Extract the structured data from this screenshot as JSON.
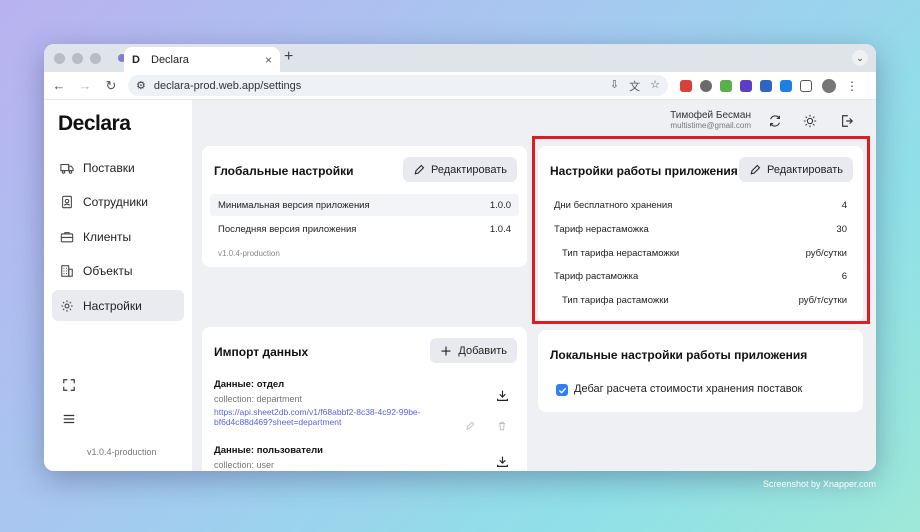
{
  "browser": {
    "tab_title": "Declara",
    "url": "declara-prod.web.app/settings"
  },
  "colors": {
    "accent": "#2d7ff9",
    "highlight": "#e11b22",
    "link": "#5b63d8"
  },
  "sidebar": {
    "logo": "Declara",
    "items": [
      {
        "label": "Поставки",
        "icon": "truck-icon"
      },
      {
        "label": "Сотрудники",
        "icon": "badge-icon"
      },
      {
        "label": "Клиенты",
        "icon": "briefcase-icon"
      },
      {
        "label": "Объекты",
        "icon": "building-icon"
      },
      {
        "label": "Настройки",
        "icon": "gear-icon"
      }
    ],
    "version": "v1.0.4-production"
  },
  "header": {
    "user_name": "Тимофей Бесман",
    "user_email": "multistime@gmail.com"
  },
  "global": {
    "title": "Глобальные настройки",
    "edit_label": "Редактировать",
    "rows": [
      {
        "label": "Минимальная версия приложения",
        "value": "1.0.0"
      },
      {
        "label": "Последняя версия приложения",
        "value": "1.0.4"
      }
    ],
    "version": "v1.0.4-production"
  },
  "app_settings": {
    "title": "Настройки работы приложения",
    "edit_label": "Редактировать",
    "rows": [
      {
        "label": "Дни бесплатного хранения",
        "value": "4"
      },
      {
        "label": "Тариф нерастаможка",
        "value": "30"
      },
      {
        "label": "Тип тарифа нерастаможки",
        "value": "руб/сутки"
      },
      {
        "label": "Тариф растаможка",
        "value": "6"
      },
      {
        "label": "Тип тарифа растаможки",
        "value": "руб/т/сутки"
      }
    ]
  },
  "import": {
    "title": "Импорт данных",
    "add_label": "Добавить",
    "items": [
      {
        "title": "Данные: отдел",
        "collection": "collection: department",
        "url": "https://api.sheet2db.com/v1/f68abbf2-8c38-4c92-99be-bf6d4c88d469?sheet=department"
      },
      {
        "title": "Данные: пользователи",
        "collection": "collection: user"
      }
    ]
  },
  "local": {
    "title": "Локальные настройки работы приложения",
    "checkbox_label": "Дебаг расчета стоимости хранения поставок",
    "checked": true
  },
  "credit": "Screenshot by Xnapper.com"
}
